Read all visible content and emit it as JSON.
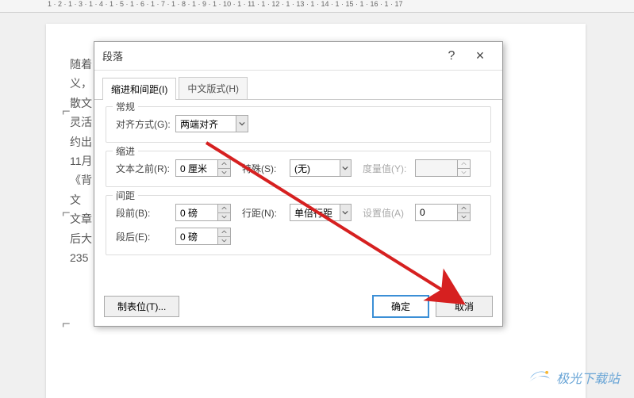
{
  "ruler_text": "1 · 2 · 1 · 3 · 1 · 4 · 1 · 5 · 1 · 6 · 1 · 7 · 1 · 8 · 1 · 9 · 1 · 10 · 1 · 11 · 1 · 12 · 1 · 13 · 1 · 14 · 1 · 15 · 1 · 16 · 1 · 17",
  "doc_lines": [
    "随着",
    "义，",
    "散文",
    "灵活",
    "约出",
    "11月",
    "《背",
    "文",
    "文章",
    "后大",
    "",
    "235"
  ],
  "dialog": {
    "title": "段落",
    "help_tooltip": "?",
    "close_tooltip": "×",
    "tabs": {
      "indent": "缩进和间距(I)",
      "asian": "中文版式(H)"
    },
    "general": {
      "legend": "常规",
      "align_label": "对齐方式(G):",
      "align_value": "两端对齐"
    },
    "indent": {
      "legend": "缩进",
      "before_label": "文本之前(R):",
      "before_value": "0 厘米",
      "special_label": "特殊(S):",
      "special_value": "(无)",
      "by_label": "度量值(Y):",
      "by_value": ""
    },
    "spacing": {
      "legend": "间距",
      "before_label": "段前(B):",
      "before_value": "0 磅",
      "line_label": "行距(N):",
      "line_value": "单倍行距",
      "at_label": "设置值(A)",
      "at_value": "0",
      "after_label": "段后(E):",
      "after_value": "0 磅"
    },
    "footer": {
      "tabstops": "制表位(T)...",
      "ok": "确定",
      "cancel": "取消"
    }
  },
  "watermark": "极光下载站"
}
